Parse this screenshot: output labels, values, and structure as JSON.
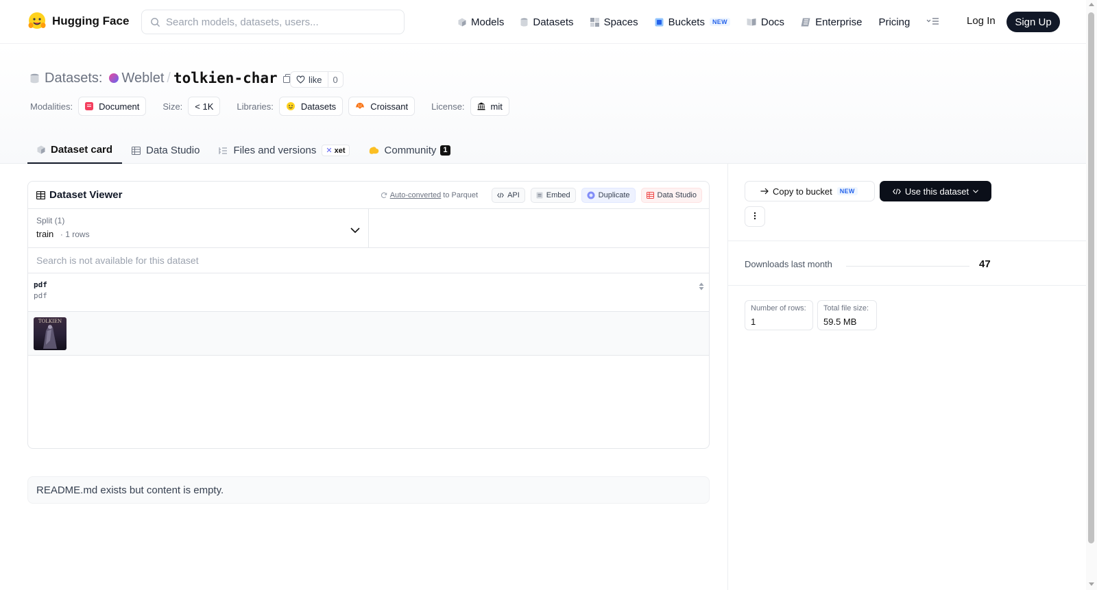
{
  "header": {
    "brand": "Hugging Face",
    "search_placeholder": "Search models, datasets, users...",
    "nav": [
      {
        "label": "Models",
        "icon": "cube-icon"
      },
      {
        "label": "Datasets",
        "icon": "database-icon"
      },
      {
        "label": "Spaces",
        "icon": "grid-icon"
      },
      {
        "label": "Buckets",
        "icon": "bucket-icon",
        "badge": "NEW"
      },
      {
        "label": "Docs",
        "icon": "book-icon"
      },
      {
        "label": "Enterprise",
        "icon": "enterprise-icon"
      },
      {
        "label": "Pricing"
      }
    ],
    "login": "Log In",
    "signup": "Sign Up"
  },
  "repo": {
    "type_label": "Datasets:",
    "owner": "Weblet",
    "separator": "/",
    "name": "tolkien-char",
    "like_label": "like",
    "like_count": "0"
  },
  "tags": {
    "modalities_label": "Modalities:",
    "modality": "Document",
    "size_label": "Size:",
    "size": "< 1K",
    "libraries_label": "Libraries:",
    "libraries": [
      "Datasets",
      "Croissant"
    ],
    "license_label": "License:",
    "license": "mit"
  },
  "tabs": [
    {
      "label": "Dataset card",
      "active": true
    },
    {
      "label": "Data Studio"
    },
    {
      "label": "Files and versions",
      "badge": "xet"
    },
    {
      "label": "Community",
      "count": "1"
    }
  ],
  "viewer": {
    "title": "Dataset Viewer",
    "auto_converted_link": "Auto-converted",
    "auto_converted_rest": "to Parquet",
    "buttons": [
      "API",
      "Embed",
      "Duplicate",
      "Data Studio"
    ],
    "split_label": "Split (1)",
    "split_value": "train",
    "split_rows": "· 1 rows",
    "search_disabled": "Search is not available for this dataset",
    "column_name": "pdf",
    "column_type": "pdf",
    "thumb_text": "TOLKIEN"
  },
  "readme": "README.md exists but content is empty.",
  "sidebar": {
    "copy_bucket": "Copy to bucket",
    "copy_bucket_badge": "NEW",
    "use_dataset": "Use this dataset",
    "downloads_label": "Downloads last month",
    "downloads_value": "47",
    "stats": [
      {
        "label": "Number of rows:",
        "value": "1"
      },
      {
        "label": "Total file size:",
        "value": "59.5 MB"
      }
    ]
  },
  "colors": {
    "primary_dark": "#111827",
    "accent_blue": "#2563eb",
    "muted": "#6b7280"
  }
}
